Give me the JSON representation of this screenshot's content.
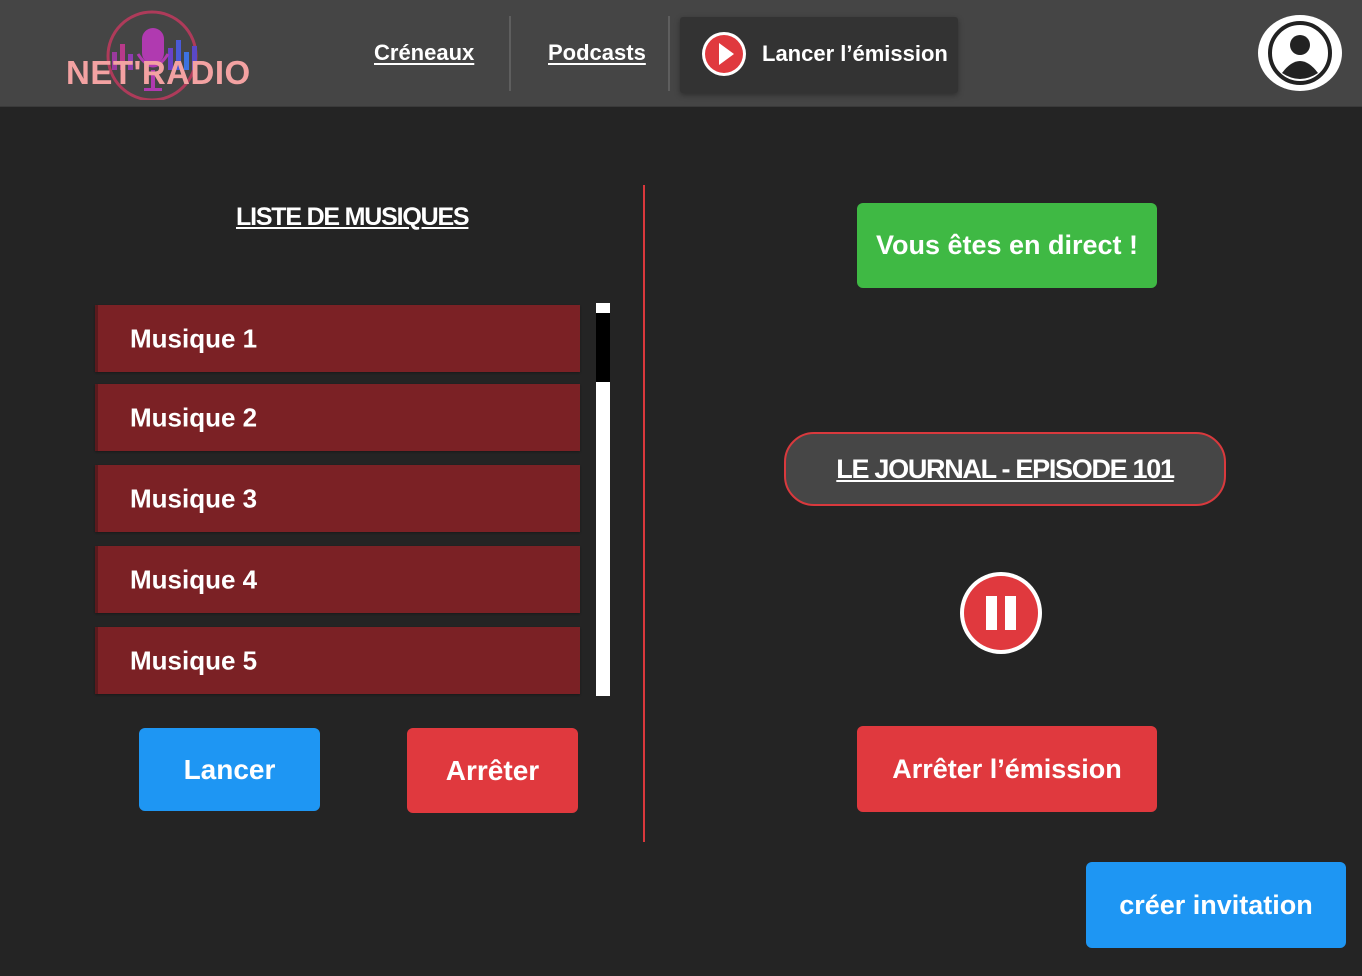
{
  "header": {
    "logo_text": "NET'RADIO",
    "nav": [
      {
        "label": "Créneaux"
      },
      {
        "label": "Podcasts"
      }
    ],
    "live_button_label": "Lancer l’émission"
  },
  "music_list": {
    "title": "LISTE DE MUSIQUES",
    "items": [
      {
        "label": "Musique 1"
      },
      {
        "label": "Musique 2"
      },
      {
        "label": "Musique 3"
      },
      {
        "label": "Musique 4"
      },
      {
        "label": "Musique 5"
      }
    ],
    "launch_label": "Lancer",
    "stop_label": "Arrêter"
  },
  "broadcast": {
    "status_label": "Vous êtes en direct !",
    "episode_title": "LE JOURNAL - EPISODE 101",
    "stop_show_label": "Arrêter l’émission",
    "invite_label": "créer invitation"
  },
  "colors": {
    "background": "#242424",
    "header": "#454545",
    "music_item": "#7b2125",
    "accent_red": "#e0393e",
    "accent_blue": "#1e96f3",
    "live_green": "#3fb944",
    "logo_pink": "#f3a2a2"
  },
  "icons": {
    "logo": "microphone-equalizer-icon",
    "live_button": "play-circle-icon",
    "avatar": "user-avatar-icon",
    "pause": "pause-circle-icon"
  }
}
